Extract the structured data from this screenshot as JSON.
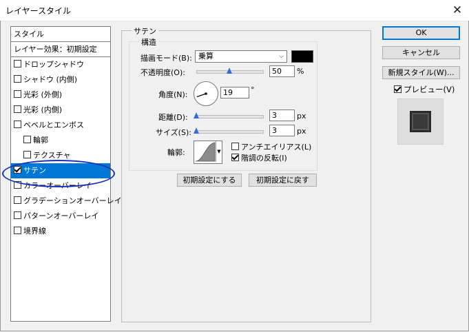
{
  "window": {
    "title": "レイヤースタイル",
    "close_icon": "close-icon"
  },
  "styles_panel": {
    "header": "スタイル",
    "items": [
      {
        "label": "レイヤー効果：初期設定",
        "checkbox": false,
        "checked": false,
        "indent": 0
      },
      {
        "label": "ドロップシャドウ",
        "checkbox": true,
        "checked": false,
        "indent": 0
      },
      {
        "label": "シャドウ (内側)",
        "checkbox": true,
        "checked": false,
        "indent": 0
      },
      {
        "label": "光彩 (外側)",
        "checkbox": true,
        "checked": false,
        "indent": 0
      },
      {
        "label": "光彩 (内側)",
        "checkbox": true,
        "checked": false,
        "indent": 0
      },
      {
        "label": "ベベルとエンボス",
        "checkbox": true,
        "checked": false,
        "indent": 0
      },
      {
        "label": "輪郭",
        "checkbox": true,
        "checked": false,
        "indent": 1
      },
      {
        "label": "テクスチャ",
        "checkbox": true,
        "checked": false,
        "indent": 1
      },
      {
        "label": "サテン",
        "checkbox": true,
        "checked": true,
        "indent": 0,
        "selected": true
      },
      {
        "label": "カラーオーバーレイ",
        "checkbox": true,
        "checked": false,
        "indent": 0
      },
      {
        "label": "グラデーションオーバーレイ",
        "checkbox": true,
        "checked": false,
        "indent": 0
      },
      {
        "label": "パターンオーバーレイ",
        "checkbox": true,
        "checked": false,
        "indent": 0
      },
      {
        "label": "境界線",
        "checkbox": true,
        "checked": false,
        "indent": 0
      }
    ]
  },
  "satin": {
    "group_title": "サテン",
    "structure_title": "構造",
    "blend_mode": {
      "label": "描画モード(B):",
      "value": "乗算",
      "color": "#000000"
    },
    "opacity": {
      "label": "不透明度(O):",
      "value": "50",
      "unit": "%",
      "fraction": 0.5
    },
    "angle": {
      "label": "角度(N):",
      "value": "19",
      "unit": "°",
      "degrees": 19
    },
    "distance": {
      "label": "距離(D):",
      "value": "3",
      "unit": "px",
      "fraction": 0.0
    },
    "size": {
      "label": "サイズ(S):",
      "value": "3",
      "unit": "px",
      "fraction": 0.0
    },
    "contour": {
      "label": "輪郭:"
    },
    "anti_alias": {
      "label": "アンチエイリアス(L)",
      "checked": false
    },
    "invert": {
      "label": "階調の反転(I)",
      "checked": true
    },
    "make_default": "初期設定にする",
    "reset_default": "初期設定に戻す"
  },
  "actions": {
    "ok": "OK",
    "cancel": "キャンセル",
    "new_style": "新規スタイル(W)...",
    "preview_label": "プレビュー(V)",
    "preview_checked": true
  },
  "annotation_color": "#1c2fbf",
  "accent_color": "#0078d7"
}
